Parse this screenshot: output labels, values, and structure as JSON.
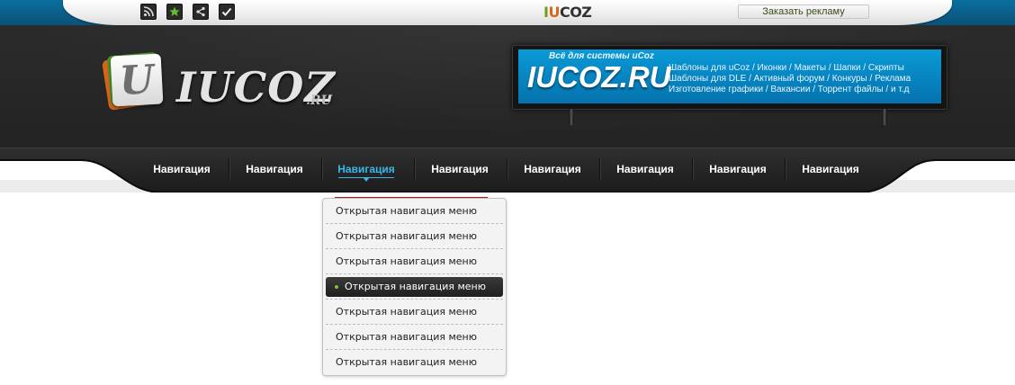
{
  "topbar": {
    "icons": [
      "rss-icon",
      "star-icon",
      "share-icon",
      "check-icon"
    ],
    "logo_accent_i": "I",
    "logo_accent_u": "U",
    "logo_rest": "COZ",
    "ad_button": "Заказать рекламу"
  },
  "header": {
    "logo_card_letter": "U",
    "logo_text": "IUCOZ",
    "logo_suffix": ".RU"
  },
  "banner": {
    "tagline": "Всё для системы uCoz",
    "title": "IUCOZ.RU",
    "lines": [
      "Шаблоны для uCoz / Иконки / Макеты / Шапки / Скрипты",
      "Шаблоны для DLE / Активный форум / Конкуры / Реклама",
      "Изготовление графики / Вакансии / Торрент файлы / и т.д"
    ]
  },
  "nav": {
    "active_index": 2,
    "items": [
      {
        "label": "Навигация"
      },
      {
        "label": "Навигация"
      },
      {
        "label": "Навигация"
      },
      {
        "label": "Навигация"
      },
      {
        "label": "Навигация"
      },
      {
        "label": "Навигация"
      },
      {
        "label": "Навигация"
      },
      {
        "label": "Навигация"
      }
    ]
  },
  "dropdown": {
    "active_index": 3,
    "items": [
      {
        "label": "Открытая навигация меню"
      },
      {
        "label": "Открытая навигация меню"
      },
      {
        "label": "Открытая навигация меню"
      },
      {
        "label": "Открытая навигация меню"
      },
      {
        "label": "Открытая навигация меню"
      },
      {
        "label": "Открытая навигация меню"
      },
      {
        "label": "Открытая навигация меню"
      }
    ]
  },
  "colors": {
    "accent_blue": "#38b8e8",
    "header_dark": "#262626",
    "dropdown_active_dot": "#7fc133",
    "dropdown_top_line": "#c01818"
  }
}
